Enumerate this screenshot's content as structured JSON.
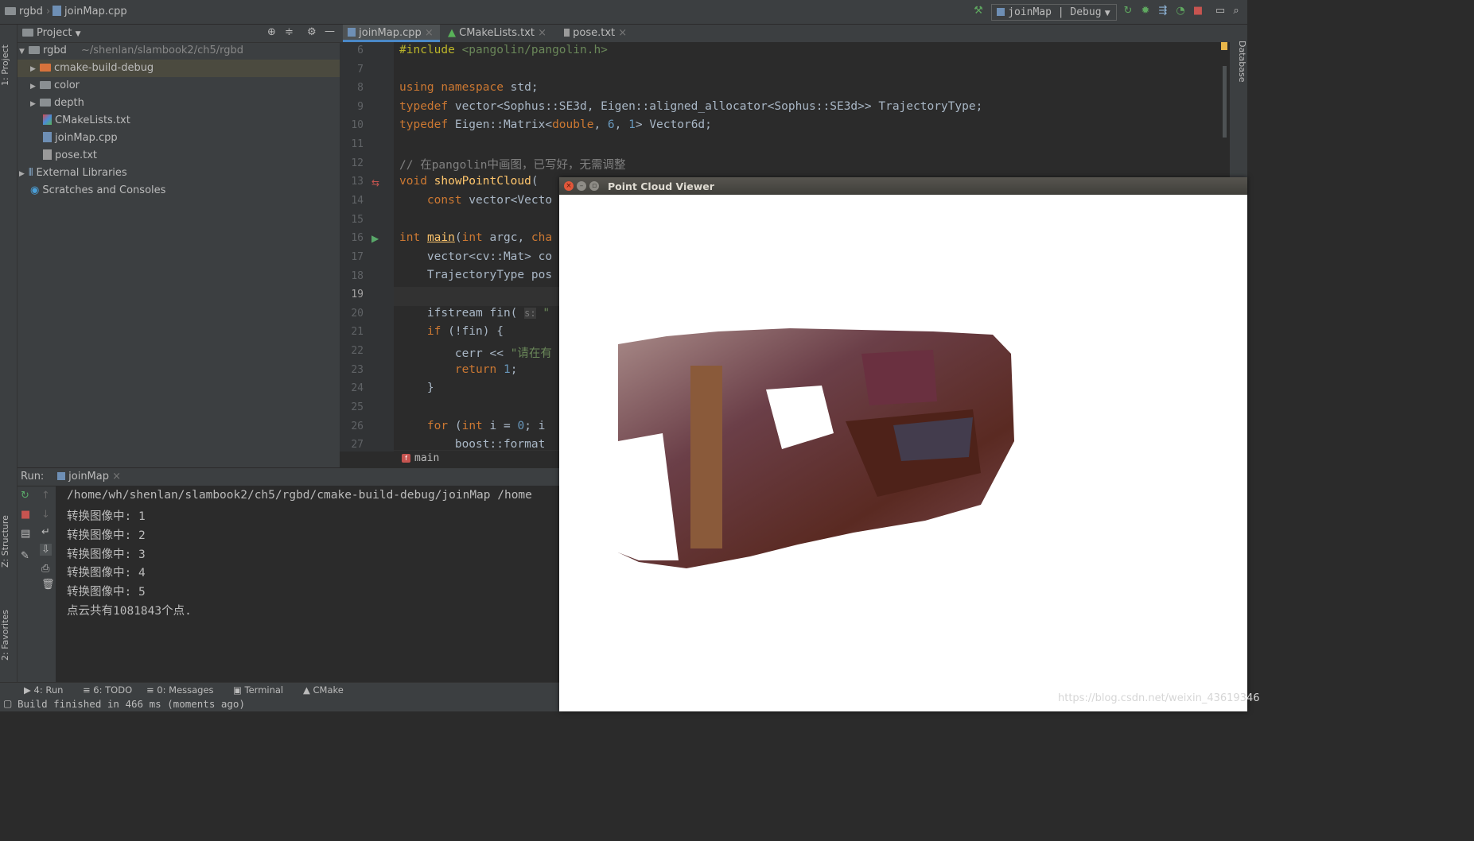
{
  "titlebar": {
    "project_crumb": "rgbd",
    "file_crumb": "joinMap.cpp",
    "run_config": "joinMap | Debug"
  },
  "side_tabs": {
    "project": "1: Project",
    "structure": "Z: Structure",
    "favorites": "2: Favorites",
    "database": "Database"
  },
  "project_panel": {
    "header": "Project",
    "tree": [
      {
        "label": "rgbd",
        "hint": "~/shenlan/slambook2/ch5/rgbd"
      },
      {
        "label": "cmake-build-debug"
      },
      {
        "label": "color"
      },
      {
        "label": "depth"
      },
      {
        "label": "CMakeLists.txt"
      },
      {
        "label": "joinMap.cpp"
      },
      {
        "label": "pose.txt"
      },
      {
        "label": "External Libraries"
      },
      {
        "label": "Scratches and Consoles"
      }
    ]
  },
  "editor": {
    "tabs": [
      {
        "label": "joinMap.cpp"
      },
      {
        "label": "CMakeLists.txt"
      },
      {
        "label": "pose.txt"
      }
    ],
    "breadcrumb": "main",
    "line_numbers": [
      "6",
      "7",
      "8",
      "9",
      "10",
      "11",
      "12",
      "13",
      "14",
      "15",
      "16",
      "17",
      "18",
      "19",
      "20",
      "21",
      "22",
      "23",
      "24",
      "25",
      "26",
      "27"
    ]
  },
  "run_panel": {
    "label": "Run:",
    "tab": "joinMap",
    "output": [
      "/home/wh/shenlan/slambook2/ch5/rgbd/cmake-build-debug/joinMap /home",
      "转换图像中: 1",
      "转换图像中: 2",
      "转换图像中: 3",
      "转换图像中: 4",
      "转换图像中: 5",
      "点云共有1081843个点."
    ]
  },
  "bottom_tabs": [
    "4: Run",
    "6: TODO",
    "0: Messages",
    "Terminal",
    "CMake"
  ],
  "status": "Build finished in 466 ms (moments ago)",
  "viewer": {
    "title": "Point Cloud Viewer"
  },
  "watermark": "https://blog.csdn.net/weixin_43619346"
}
